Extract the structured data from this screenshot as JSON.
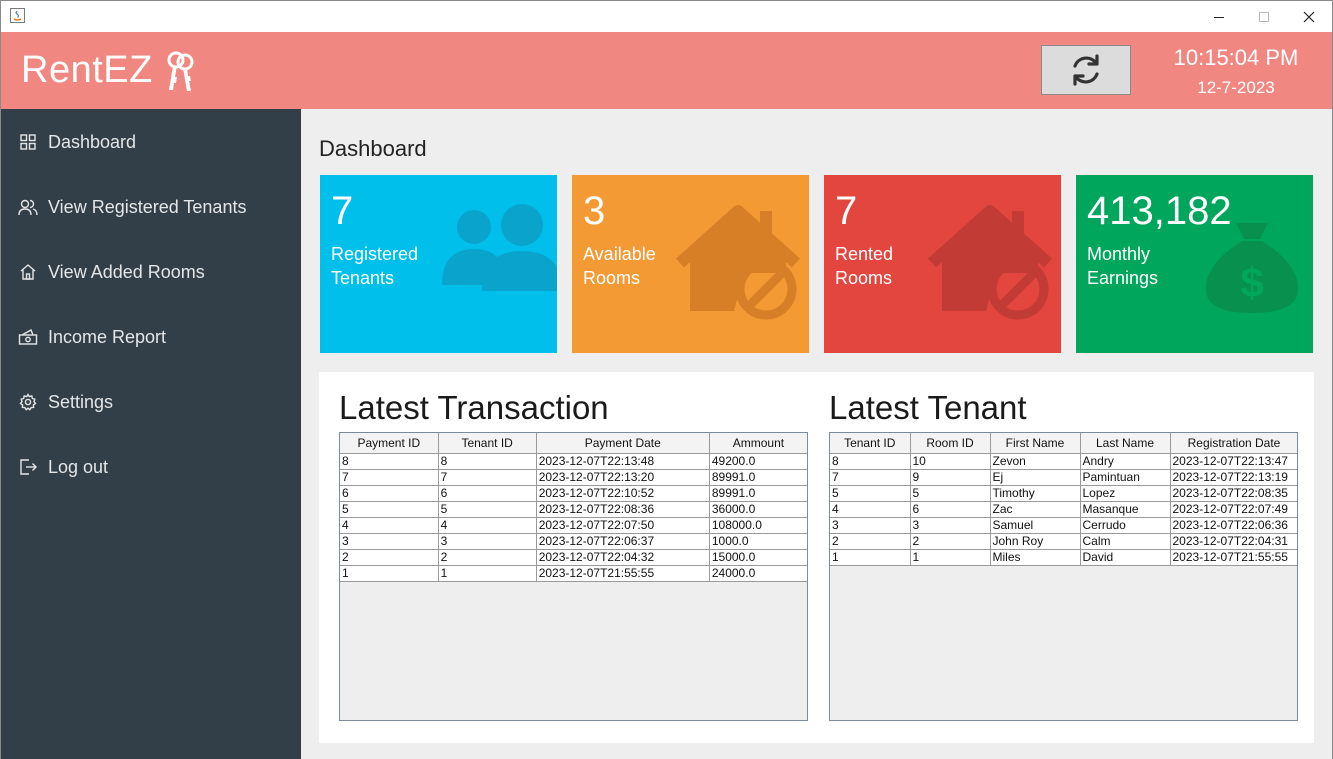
{
  "app": {
    "name": "RentEZ"
  },
  "header": {
    "time": "10:15:04 PM",
    "date": "12-7-2023"
  },
  "sidebar": {
    "items": [
      {
        "label": "Dashboard",
        "icon": "grid-icon"
      },
      {
        "label": "View Registered Tenants",
        "icon": "users-icon"
      },
      {
        "label": "View Added Rooms",
        "icon": "home-icon"
      },
      {
        "label": "Income Report",
        "icon": "cash-icon"
      },
      {
        "label": "Settings",
        "icon": "gear-icon"
      },
      {
        "label": "Log out",
        "icon": "logout-icon"
      }
    ]
  },
  "main": {
    "title": "Dashboard",
    "cards": [
      {
        "value": "7",
        "label1": "Registered",
        "label2": "Tenants",
        "color": "#00bfea",
        "icon": "users-icon"
      },
      {
        "value": "3",
        "label1": "Available",
        "label2": "Rooms",
        "color": "#f39a35",
        "icon": "house-blocked-icon"
      },
      {
        "value": "7",
        "label1": "Rented",
        "label2": "Rooms",
        "color": "#e2463f",
        "icon": "house-blocked-icon"
      },
      {
        "value": "413,182",
        "label1": "Monthly",
        "label2": "Earnings",
        "color": "#00a65b",
        "icon": "money-bag-icon"
      }
    ],
    "transactions": {
      "title": "Latest Transaction",
      "columns": [
        "Payment ID",
        "Tenant ID",
        "Payment Date",
        "Ammount"
      ],
      "rows": [
        [
          "8",
          "8",
          "2023-12-07T22:13:48",
          "49200.0"
        ],
        [
          "7",
          "7",
          "2023-12-07T22:13:20",
          "89991.0"
        ],
        [
          "6",
          "6",
          "2023-12-07T22:10:52",
          "89991.0"
        ],
        [
          "5",
          "5",
          "2023-12-07T22:08:36",
          "36000.0"
        ],
        [
          "4",
          "4",
          "2023-12-07T22:07:50",
          "108000.0"
        ],
        [
          "3",
          "3",
          "2023-12-07T22:06:37",
          "1000.0"
        ],
        [
          "2",
          "2",
          "2023-12-07T22:04:32",
          "15000.0"
        ],
        [
          "1",
          "1",
          "2023-12-07T21:55:55",
          "24000.0"
        ]
      ]
    },
    "tenants": {
      "title": "Latest Tenant",
      "columns": [
        "Tenant ID",
        "Room ID",
        "First Name",
        "Last Name",
        "Registration Date"
      ],
      "rows": [
        [
          "8",
          "10",
          "Zevon",
          "Andry",
          "2023-12-07T22:13:47"
        ],
        [
          "7",
          "9",
          "Ej",
          "Pamintuan",
          "2023-12-07T22:13:19"
        ],
        [
          "5",
          "5",
          "Timothy",
          "Lopez",
          "2023-12-07T22:08:35"
        ],
        [
          "4",
          "6",
          "Zac",
          "Masanque",
          "2023-12-07T22:07:49"
        ],
        [
          "3",
          "3",
          "Samuel",
          "Cerrudo",
          "2023-12-07T22:06:36"
        ],
        [
          "2",
          "2",
          "John Roy",
          "Calm",
          "2023-12-07T22:04:31"
        ],
        [
          "1",
          "1",
          "Miles",
          "David",
          "2023-12-07T21:55:55"
        ]
      ]
    }
  }
}
